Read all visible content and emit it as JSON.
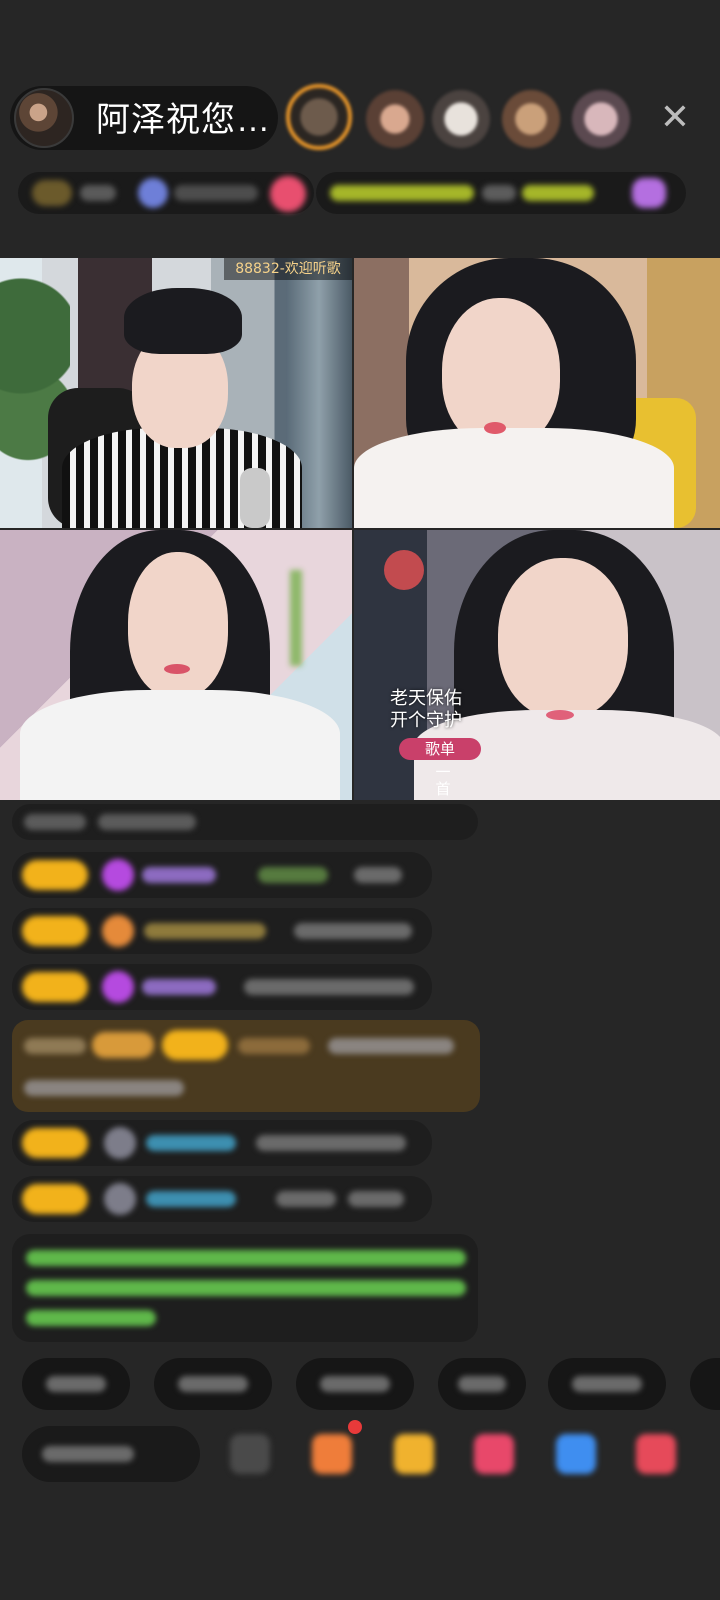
{
  "header": {
    "host_name": "阿泽祝您…",
    "close_icon": "close-icon"
  },
  "video_grid": {
    "tile1_label": "88832-欢迎听歌",
    "tile4_overlay_line1": "老天保佑",
    "tile4_overlay_line2": "开个守护",
    "tile4_song_button": "歌单",
    "tile4_vertical_text": "一首"
  },
  "colors": {
    "background": "#262626",
    "badge_gold": "#f2b21b",
    "song_button": "#c9406a",
    "highlight_message": "#4a3a1f",
    "system_text_green": "#5fb84a"
  }
}
